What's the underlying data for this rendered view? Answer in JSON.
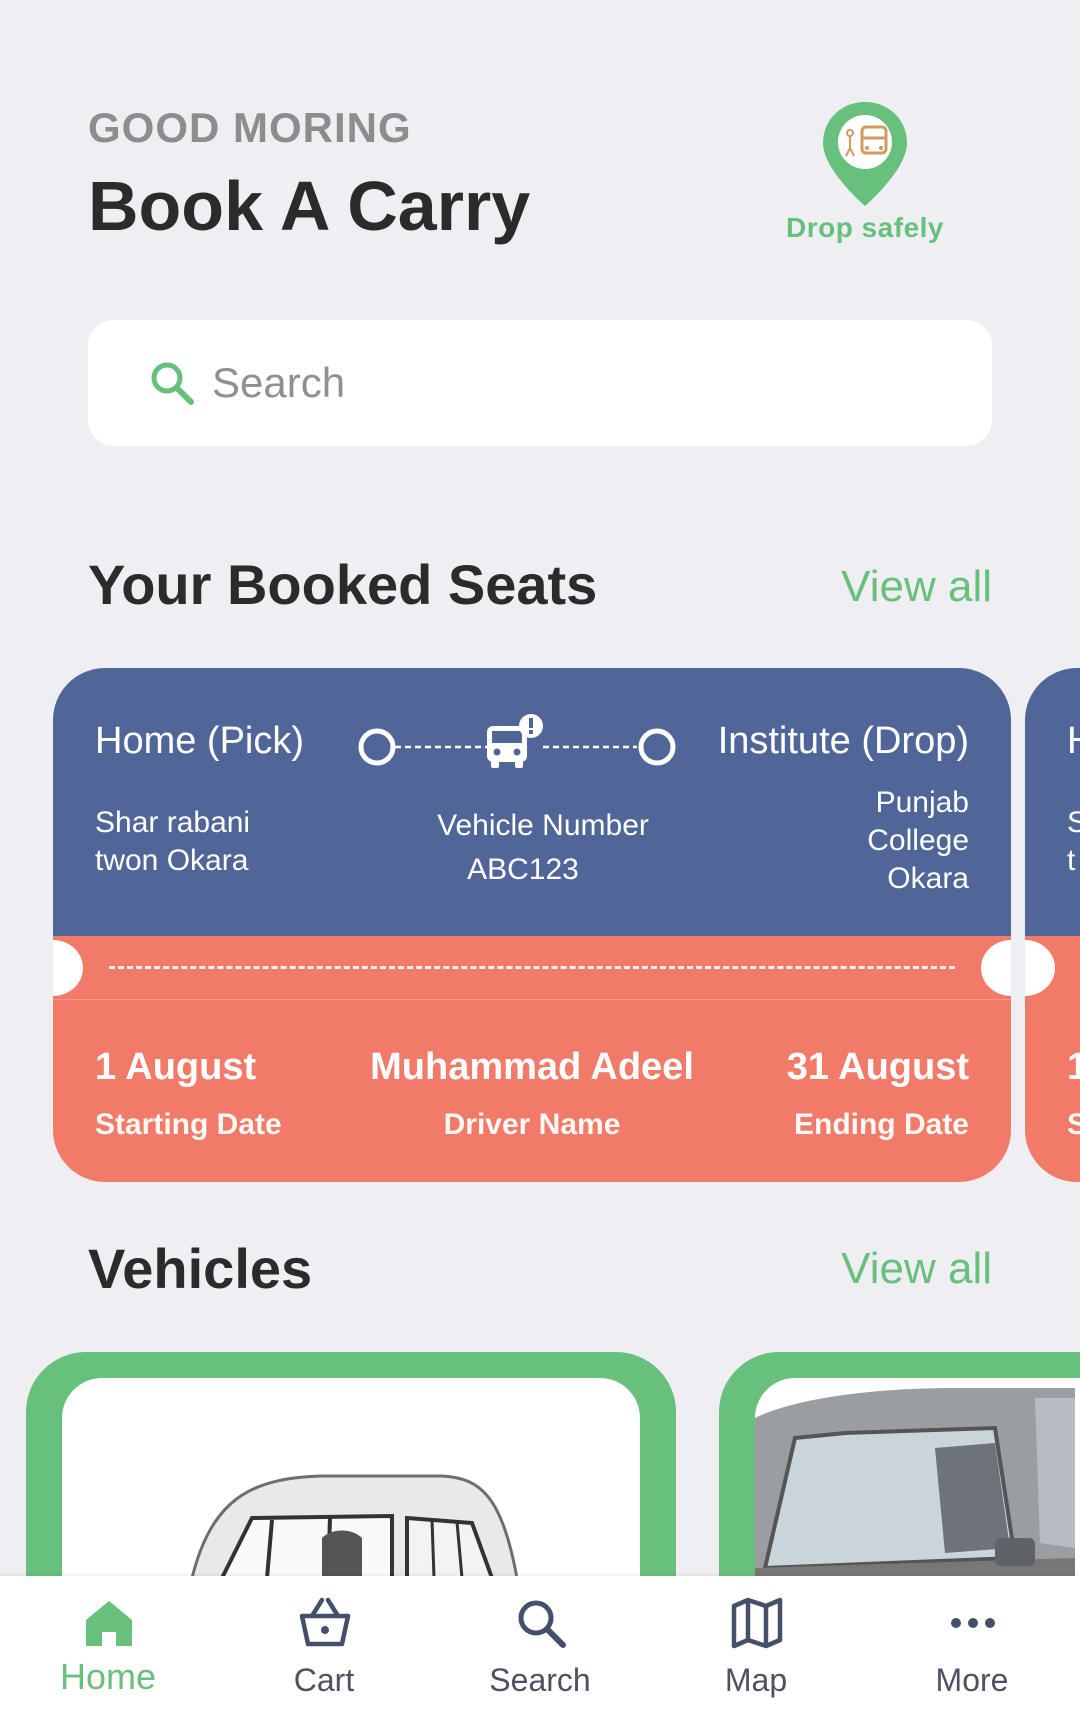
{
  "header": {
    "greeting": "GOOD MORING",
    "title": "Book A Carry",
    "logo_text": "Drop safely"
  },
  "search": {
    "placeholder": "Search"
  },
  "booked": {
    "section_title": "Your Booked Seats",
    "view_all": "View all",
    "cards": [
      {
        "pick_label": "Home (Pick)",
        "drop_label": "Institute (Drop)",
        "pick_address_line1": "Shar rabani",
        "pick_address_line2": "twon Okara",
        "vehicle_label": "Vehicle Number",
        "vehicle_number": "ABC123",
        "drop_address_line1": "Punjab",
        "drop_address_line2": "College",
        "drop_address_line3": "Okara",
        "start_date": "1 August",
        "start_label": "Starting Date",
        "driver_name": "Muhammad Adeel",
        "driver_label": "Driver Name",
        "end_date": "31 August",
        "end_label": "Ending Date"
      },
      {
        "pick_label": "H",
        "pick_address_line1": "S",
        "pick_address_line2": "t",
        "start_date": "1",
        "start_label": "S"
      }
    ]
  },
  "vehicles": {
    "section_title": "Vehicles",
    "view_all": "View all"
  },
  "nav": {
    "items": [
      {
        "label": "Home",
        "icon": "home-icon",
        "active": true
      },
      {
        "label": "Cart",
        "icon": "cart-icon"
      },
      {
        "label": "Search",
        "icon": "search-icon"
      },
      {
        "label": "Map",
        "icon": "map-icon"
      },
      {
        "label": "More",
        "icon": "more-icon"
      }
    ]
  },
  "colors": {
    "accent_green": "#67c07c",
    "card_blue": "#506598",
    "card_coral": "#f27a68",
    "background": "#efeff3",
    "text_dark": "#2b2b2b"
  }
}
